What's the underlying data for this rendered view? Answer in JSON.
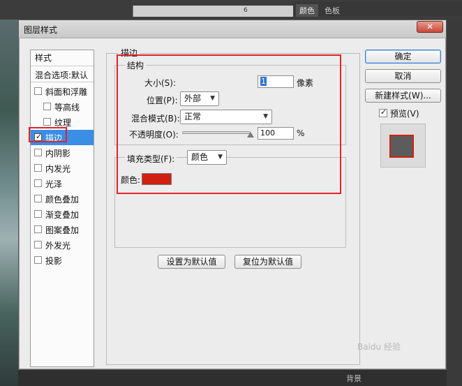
{
  "workspace": {
    "ruler_labels": [
      "6"
    ],
    "panel_tabs": [
      "颜色",
      "色板"
    ],
    "bottom_text": "背景"
  },
  "dialog": {
    "title": "图层样式",
    "close_icon": "close-icon",
    "style_list": {
      "header": "样式",
      "blend_options": "混合选项:默认",
      "items": [
        {
          "label": "斜面和浮雕",
          "checked": false
        },
        {
          "label": "等高线",
          "checked": false
        },
        {
          "label": "纹理",
          "checked": false
        },
        {
          "label": "描边",
          "checked": true,
          "selected": true
        },
        {
          "label": "内阴影",
          "checked": false
        },
        {
          "label": "内发光",
          "checked": false
        },
        {
          "label": "光泽",
          "checked": false
        },
        {
          "label": "颜色叠加",
          "checked": false
        },
        {
          "label": "渐变叠加",
          "checked": false
        },
        {
          "label": "图案叠加",
          "checked": false
        },
        {
          "label": "外发光",
          "checked": false
        },
        {
          "label": "投影",
          "checked": false
        }
      ]
    },
    "stroke": {
      "group_title": "描边",
      "structure_title": "结构",
      "size_label": "大小(S):",
      "size_value": "1",
      "size_unit": "像素",
      "position_label": "位置(P):",
      "position_value": "外部",
      "blend_mode_label": "混合模式(B):",
      "blend_mode_value": "正常",
      "opacity_label": "不透明度(O):",
      "opacity_value": "100",
      "opacity_unit": "%",
      "opacity_fraction": 1.0,
      "fill_type_label": "填充类型(F):",
      "fill_type_value": "颜色",
      "color_label": "颜色:",
      "color": "#d02010"
    },
    "buttons": {
      "ok": "确定",
      "cancel": "取消",
      "new_style": "新建样式(W)...",
      "make_default": "设置为默认值",
      "reset_default": "复位为默认值"
    },
    "preview_label": "预览(V)",
    "preview_checked": true
  },
  "watermark": "Baidu 经验"
}
